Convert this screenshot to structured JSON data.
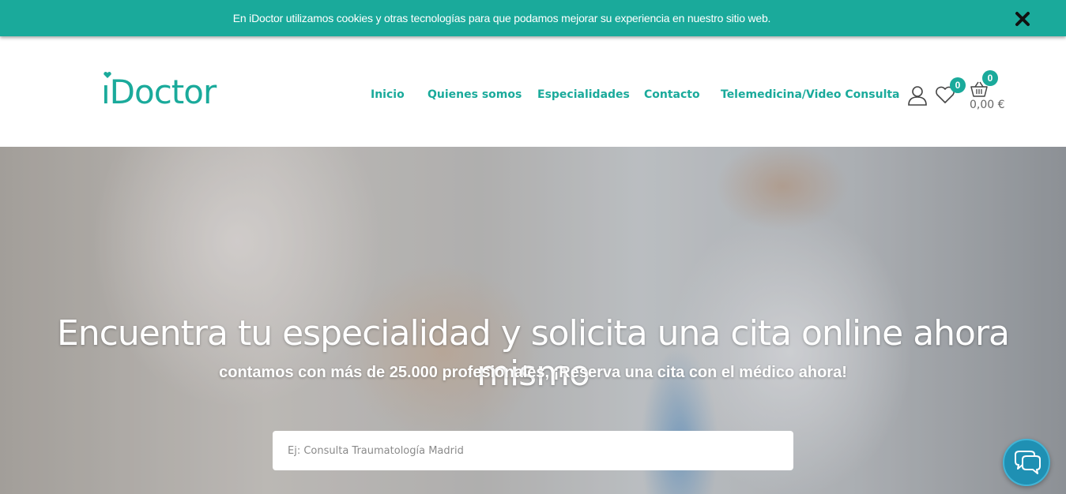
{
  "cookie_bar": {
    "text": "En iDoctor utilizamos cookies y otras tecnologías para que podamos mejorar su experiencia en nuestro sitio web.",
    "close_icon": "close-icon"
  },
  "header": {
    "logo_text": "Doctor",
    "nav": [
      "Inicio",
      "Quienes somos",
      "Especialidades",
      "Contacto",
      "Telemedicina/Video Consulta"
    ],
    "wishlist_count": "0",
    "cart_count": "0",
    "cart_total": "0,00 €"
  },
  "hero": {
    "title": "Encuentra tu especialidad y solicita una cita online ahora mismo",
    "subtitle": "contamos con más de 25.000 profesionales, ¡Reserva una cita con el médico ahora!",
    "search_placeholder": "Ej: Consulta Traumatología Madrid"
  },
  "colors": {
    "brand": "#1aaa9b",
    "chat_button": "#1f90b3"
  }
}
